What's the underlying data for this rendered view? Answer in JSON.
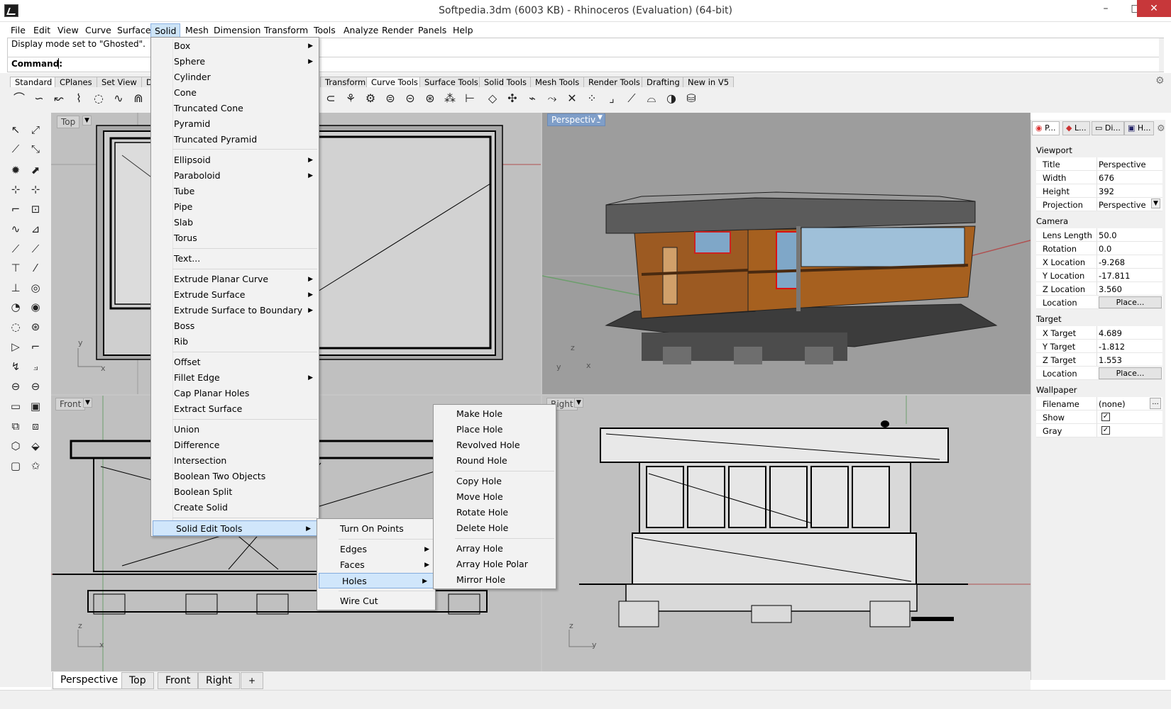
{
  "window": {
    "title": "Softpedia.3dm (6003 KB) - Rhinoceros (Evaluation) (64-bit)"
  },
  "menubar": [
    "File",
    "Edit",
    "View",
    "Curve",
    "Surface",
    "Solid",
    "Mesh",
    "Dimension",
    "Transform",
    "Tools",
    "Analyze",
    "Render",
    "Panels",
    "Help"
  ],
  "command": {
    "history": "Display mode set to \"Ghosted\".",
    "prompt": "Command:"
  },
  "toolbar_tabs": [
    "Standard",
    "CPlanes",
    "Set View",
    "D",
    "Transform",
    "Curve Tools",
    "Surface Tools",
    "Solid Tools",
    "Mesh Tools",
    "Render Tools",
    "Drafting",
    "New in V5"
  ],
  "viewports": {
    "top": {
      "label": "Top",
      "axis_y": "y",
      "axis_x": "x"
    },
    "perspective": {
      "label": "Perspective",
      "axis_z": "z",
      "axis_y": "y",
      "axis_x": "x"
    },
    "front": {
      "label": "Front",
      "axis_z": "z",
      "axis_x": "x"
    },
    "right": {
      "label": "Right",
      "axis_z": "z",
      "axis_y": "y"
    }
  },
  "properties": {
    "tabs": [
      "P...",
      "L...",
      "Di...",
      "H..."
    ],
    "viewport_section": "Viewport",
    "title_k": "Title",
    "title_v": "Perspective",
    "width_k": "Width",
    "width_v": "676",
    "height_k": "Height",
    "height_v": "392",
    "projection_k": "Projection",
    "projection_v": "Perspective",
    "camera_section": "Camera",
    "lens_k": "Lens Length",
    "lens_v": "50.0",
    "rotation_k": "Rotation",
    "rotation_v": "0.0",
    "xloc_k": "X Location",
    "xloc_v": "-9.268",
    "yloc_k": "Y Location",
    "yloc_v": "-17.811",
    "zloc_k": "Z Location",
    "zloc_v": "3.560",
    "loc_k": "Location",
    "place_btn": "Place...",
    "target_section": "Target",
    "xt_k": "X Target",
    "xt_v": "4.689",
    "yt_k": "Y Target",
    "yt_v": "-1.812",
    "zt_k": "Z Target",
    "zt_v": "1.553",
    "tloc_k": "Location",
    "wallpaper_section": "Wallpaper",
    "file_k": "Filename",
    "file_v": "(none)",
    "file_btn": "...",
    "show_k": "Show",
    "gray_k": "Gray"
  },
  "solid_menu": [
    "Box",
    "Sphere",
    "Cylinder",
    "Cone",
    "Truncated Cone",
    "Pyramid",
    "Truncated Pyramid",
    "Ellipsoid",
    "Paraboloid",
    "Tube",
    "Pipe",
    "Slab",
    "Torus",
    "Text...",
    "Extrude Planar Curve",
    "Extrude Surface",
    "Extrude Surface to Boundary",
    "Boss",
    "Rib",
    "Offset",
    "Fillet Edge",
    "Cap Planar Holes",
    "Extract Surface",
    "Union",
    "Difference",
    "Intersection",
    "Boolean Two Objects",
    "Boolean Split",
    "Create Solid",
    "Solid Edit Tools"
  ],
  "solid_edit_menu": [
    "Turn On Points",
    "Edges",
    "Faces",
    "Holes",
    "Wire Cut"
  ],
  "holes_menu": [
    "Make Hole",
    "Place Hole",
    "Revolved Hole",
    "Round Hole",
    "Copy Hole",
    "Move Hole",
    "Rotate Hole",
    "Delete Hole",
    "Array Hole",
    "Array Hole Polar",
    "Mirror Hole"
  ],
  "bottom_tabs": [
    "Perspective",
    "Top",
    "Front",
    "Right",
    "+"
  ],
  "colors": {
    "accent": "#cde4f7",
    "close": "#c7373a",
    "viewport_bg": "#c0c0c0",
    "active_view": "#7f9ec8"
  }
}
